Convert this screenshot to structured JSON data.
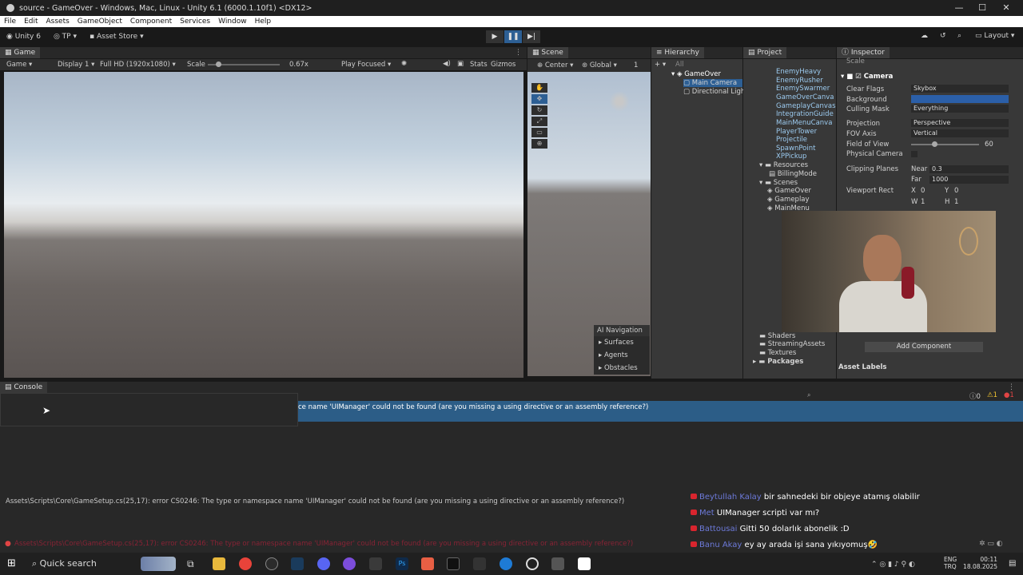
{
  "window": {
    "title": "source - GameOver - Windows, Mac, Linux - Unity 6.1 (6000.1.10f1) <DX12>"
  },
  "menu": [
    "File",
    "Edit",
    "Assets",
    "GameObject",
    "Component",
    "Services",
    "Window",
    "Help"
  ],
  "toolbar": {
    "unity": "Unity 6",
    "tp": "TP",
    "asset_store": "Asset Store",
    "layout": "Layout"
  },
  "game": {
    "tab": "Game",
    "mode": "Game",
    "display": "Display 1",
    "res": "Full HD (1920x1080)",
    "scale_label": "Scale",
    "scale_val": "0.67x",
    "play_focused": "Play Focused",
    "stats": "Stats",
    "gizmos": "Gizmos"
  },
  "scene": {
    "tab": "Scene",
    "center": "Center",
    "global": "Global",
    "count": "1",
    "nav_title": "AI Navigation",
    "nav_items": [
      "Surfaces",
      "Agents",
      "Obstacles"
    ]
  },
  "hierarchy": {
    "tab": "Hierarchy",
    "search": "All",
    "root": "GameOver",
    "items": [
      "Main Camera",
      "Directional Light"
    ]
  },
  "project": {
    "tab": "Project",
    "prefabs": [
      "EnemyHeavy",
      "EnemyRusher",
      "EnemySwarmer",
      "GameOverCanva",
      "GameplayCanvas",
      "IntegrationGuide",
      "MainMenuCanva",
      "PlayerTower",
      "Projectile",
      "SpawnPoint",
      "XPPickup"
    ],
    "resources": "Resources",
    "billing": "BillingMode",
    "scenes": "Scenes",
    "scene_items": [
      "GameOver",
      "Gameplay",
      "MainMenu"
    ],
    "folders": [
      "Shaders",
      "StreamingAssets",
      "Textures"
    ],
    "packages": "Packages"
  },
  "inspector": {
    "tab": "Inspector",
    "component": "Camera",
    "scale": "Scale",
    "props": [
      {
        "label": "Clear Flags",
        "value": "Skybox"
      },
      {
        "label": "Background",
        "value": ""
      },
      {
        "label": "Culling Mask",
        "value": "Everything"
      },
      {
        "label": "Projection",
        "value": "Perspective"
      },
      {
        "label": "FOV Axis",
        "value": "Vertical"
      },
      {
        "label": "Field of View",
        "value": "60"
      },
      {
        "label": "Physical Camera",
        "value": ""
      }
    ],
    "clip_label": "Clipping Planes",
    "near_label": "Near",
    "near": "0.3",
    "far_label": "Far",
    "far": "1000",
    "vr_label": "Viewport Rect",
    "x_label": "X",
    "x": "0",
    "y_label": "Y",
    "y": "0",
    "w_label": "W",
    "w": "1",
    "h_label": "H",
    "h": "1",
    "add_component": "Add Component",
    "asset_labels": "Asset Labels"
  },
  "console": {
    "tab": "Console",
    "counts": {
      "info": "0",
      "warn": "1",
      "error": "1"
    },
    "band_text": "ce name 'UIManager' could not be found (are you missing a using directive or an assembly reference?)",
    "detail": "Assets\\Scripts\\Core\\GameSetup.cs(25,17): error CS0246: The type or namespace name 'UIManager' could not be found (are you missing a using directive or an assembly reference?)",
    "status": "Assets\\Scripts\\Core\\GameSetup.cs(25,17): error CS0246: The type or namespace name 'UIManager' could not be found (are you missing a using directive or an assembly reference?)"
  },
  "chat": [
    {
      "name": "Beytullah Kalay",
      "msg": "bir sahnedeki bir objeye atamış olabilir"
    },
    {
      "name": "Met",
      "msg": "UIManager scripti var mı?"
    },
    {
      "name": "Battousai",
      "msg": "Gitti 50 dolarlık abonelik :D"
    },
    {
      "name": "Banu Akay",
      "msg": "ey ay arada işi sana yıkıyomuş🤣"
    }
  ],
  "taskbar": {
    "search": "Quick search",
    "lang1": "ENG",
    "lang2": "TRQ",
    "time": "00:11",
    "date": "18.08.2025"
  }
}
